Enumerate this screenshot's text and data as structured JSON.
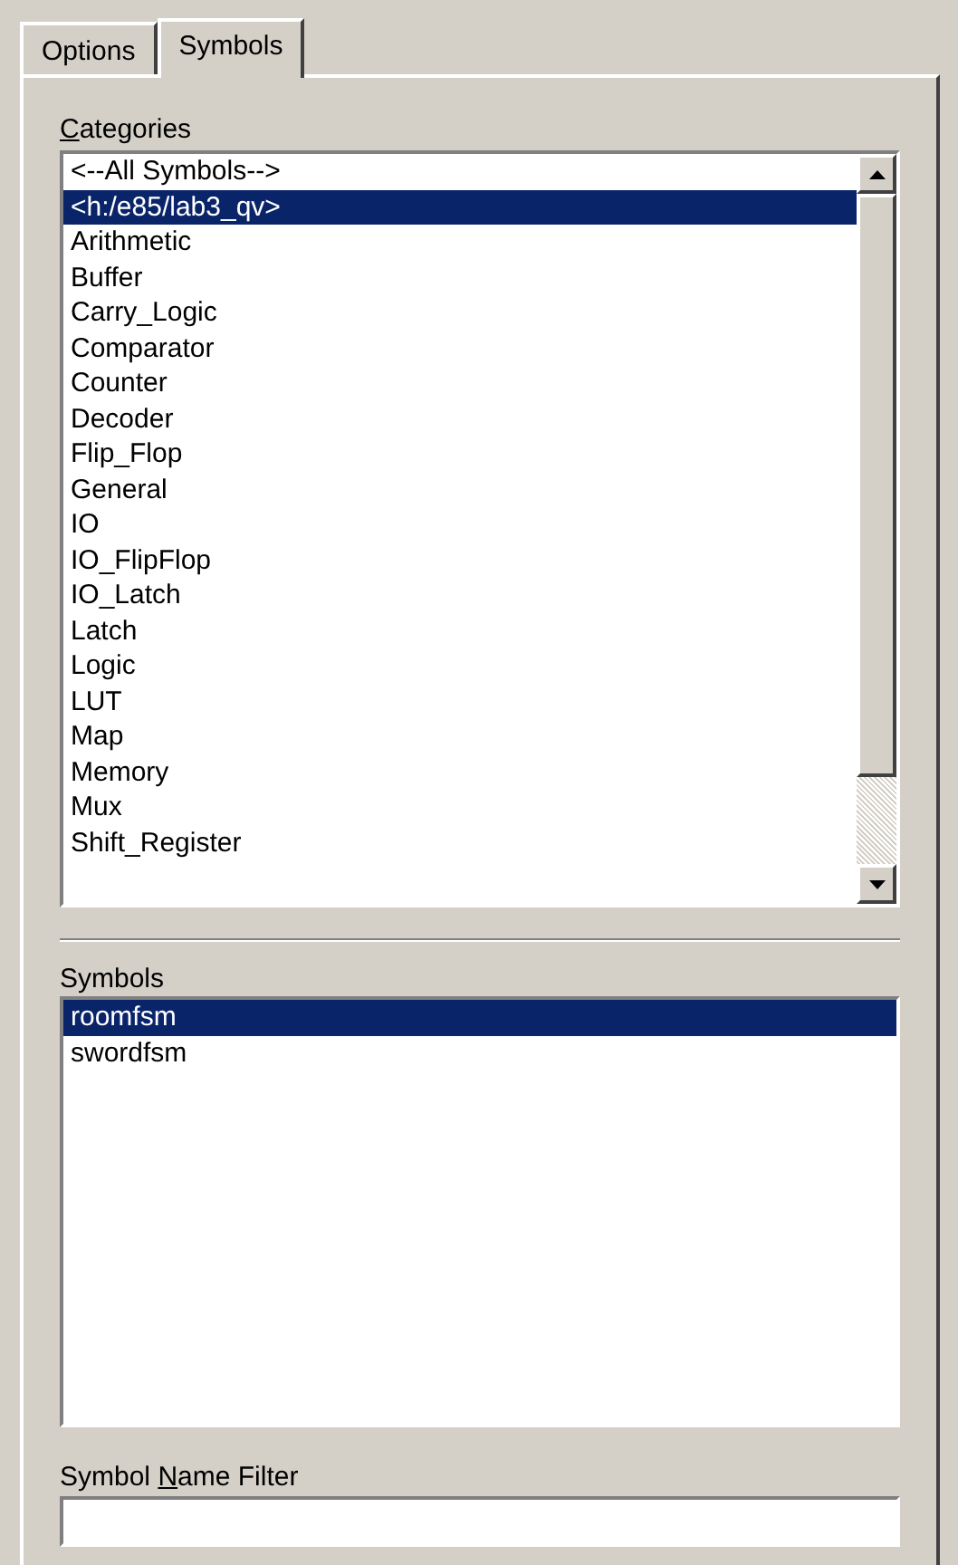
{
  "tabs": [
    {
      "label": "Options",
      "selected": false
    },
    {
      "label": "Symbols",
      "selected": true
    }
  ],
  "categories": {
    "label": {
      "mnemonic": "C",
      "rest": "ategories"
    },
    "items": [
      {
        "label": "<--All Symbols-->",
        "selected": false
      },
      {
        "label": "<h:/e85/lab3_qv>",
        "selected": true
      },
      {
        "label": "Arithmetic",
        "selected": false
      },
      {
        "label": "Buffer",
        "selected": false
      },
      {
        "label": "Carry_Logic",
        "selected": false
      },
      {
        "label": "Comparator",
        "selected": false
      },
      {
        "label": "Counter",
        "selected": false
      },
      {
        "label": "Decoder",
        "selected": false
      },
      {
        "label": "Flip_Flop",
        "selected": false
      },
      {
        "label": "General",
        "selected": false
      },
      {
        "label": "IO",
        "selected": false
      },
      {
        "label": "IO_FlipFlop",
        "selected": false
      },
      {
        "label": "IO_Latch",
        "selected": false
      },
      {
        "label": "Latch",
        "selected": false
      },
      {
        "label": "Logic",
        "selected": false
      },
      {
        "label": "LUT",
        "selected": false
      },
      {
        "label": "Map",
        "selected": false
      },
      {
        "label": "Memory",
        "selected": false
      },
      {
        "label": "Mux",
        "selected": false
      },
      {
        "label": "Shift_Register",
        "selected": false
      }
    ]
  },
  "symbols": {
    "label": "Symbols",
    "items": [
      {
        "label": "roomfsm",
        "selected": true
      },
      {
        "label": "swordfsm",
        "selected": false
      }
    ]
  },
  "filter": {
    "label": {
      "before": "Symbol ",
      "mnemonic": "N",
      "rest": "ame Filter"
    }
  }
}
